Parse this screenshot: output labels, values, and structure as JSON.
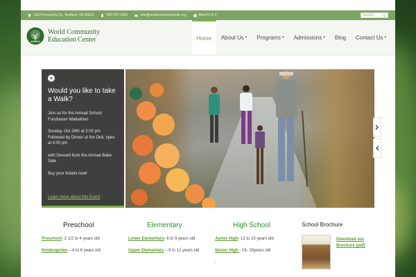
{
  "topbar": {
    "address": "1329 Prosperity Dr., Bedford, VA 24523",
    "phone": "540-297-1662",
    "email": "info@worldcommunityedu.org",
    "hours": "Mon-Fri 9-3",
    "search_placeholder": "Search..."
  },
  "brand": {
    "line1": "World Community",
    "line2": "Education Center"
  },
  "nav": {
    "items": [
      {
        "label": "Home",
        "active": true
      },
      {
        "label": "About Us",
        "caret": "▾"
      },
      {
        "label": "Programs",
        "caret": "▾"
      },
      {
        "label": "Admissions",
        "caret": "▾"
      },
      {
        "label": "Blog"
      },
      {
        "label": "Contact Us",
        "caret": "▾"
      }
    ]
  },
  "hero": {
    "title": "Would you like to take a Walk?",
    "p1": "Join us for the Annual School Fundraiser Walkathon",
    "p2": "Sunday, Oct 26th at 2:00 pm Followed by Dinner at the Deli, open at 4:00 pm",
    "p3": "with Dessert from the Annual Bake Sale",
    "p4": "Buy your tickets now!",
    "more": "Learn more about this Event"
  },
  "columns": {
    "preschool": {
      "title": "Preschool",
      "rows": [
        {
          "link": "Preschool",
          "text": "- 2 1/2 to 4 years old"
        },
        {
          "link": "Kindergarten",
          "text": " – 4 to 6 years old"
        }
      ]
    },
    "elementary": {
      "title": "Elementary",
      "rows": [
        {
          "link": "Lower Elementary",
          "text": "- 6 to 9 years old"
        },
        {
          "link": "Upper Elementary",
          "text": " – 9 to 12 years old"
        }
      ]
    },
    "highschool": {
      "title": "High School",
      "rows": [
        {
          "link": "Junior High",
          "text": "- 12 to 15 years old"
        },
        {
          "link": "Senior High ",
          "text": "- 15- 18years old"
        }
      ],
      "trailing": "."
    },
    "brochure": {
      "title": "School Brochure",
      "link": "Download our Brochure (pdf)"
    }
  },
  "colors": {
    "accent_green": "#7fb04a",
    "topbar_green": "#7da364",
    "panel_dark": "#3f403d"
  }
}
